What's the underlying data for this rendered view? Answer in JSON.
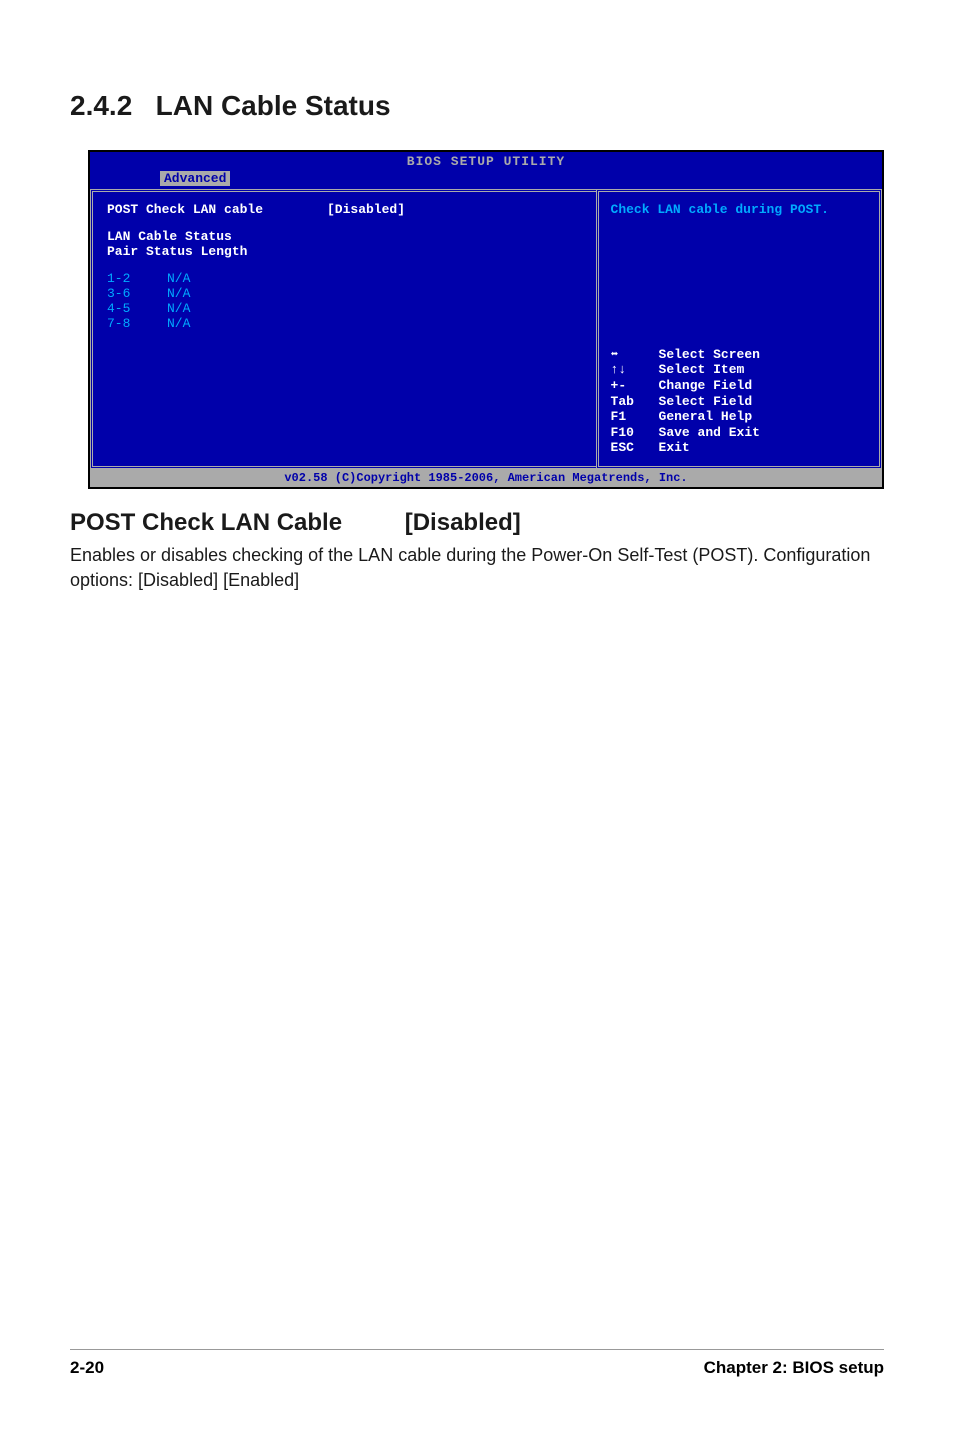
{
  "section": {
    "number": "2.4.2",
    "title": "LAN Cable Status"
  },
  "bios": {
    "header": "BIOS SETUP UTILITY",
    "tab": "Advanced",
    "left": {
      "field_label": "POST Check LAN cable",
      "field_value": "[Disabled]",
      "status_header1": "LAN Cable Status",
      "status_header2": "Pair  Status  Length",
      "rows": [
        {
          "pair": "1-2",
          "status": "N/A"
        },
        {
          "pair": "3-6",
          "status": "N/A"
        },
        {
          "pair": "4-5",
          "status": "N/A"
        },
        {
          "pair": "7-8",
          "status": "N/A"
        }
      ]
    },
    "right": {
      "help": "Check LAN cable during POST.",
      "nav": {
        "select_screen": "Select Screen",
        "select_item": "Select Item",
        "change_field_key": "+-",
        "change_field": "Change Field",
        "select_field_key": "Tab",
        "select_field": "Select Field",
        "general_help_key": "F1",
        "general_help": "General Help",
        "save_exit_key": "F10",
        "save_exit": "Save and Exit",
        "exit_key": "ESC",
        "exit": "Exit"
      }
    },
    "footer": "v02.58 (C)Copyright 1985-2006, American Megatrends, Inc."
  },
  "subsection": {
    "title": "POST Check LAN Cable",
    "value": "[Disabled]",
    "description": "Enables or disables checking of the LAN cable during the Power-On Self-Test (POST). Configuration options: [Disabled] [Enabled]"
  },
  "footer": {
    "page": "2-20",
    "chapter": "Chapter 2: BIOS setup"
  }
}
